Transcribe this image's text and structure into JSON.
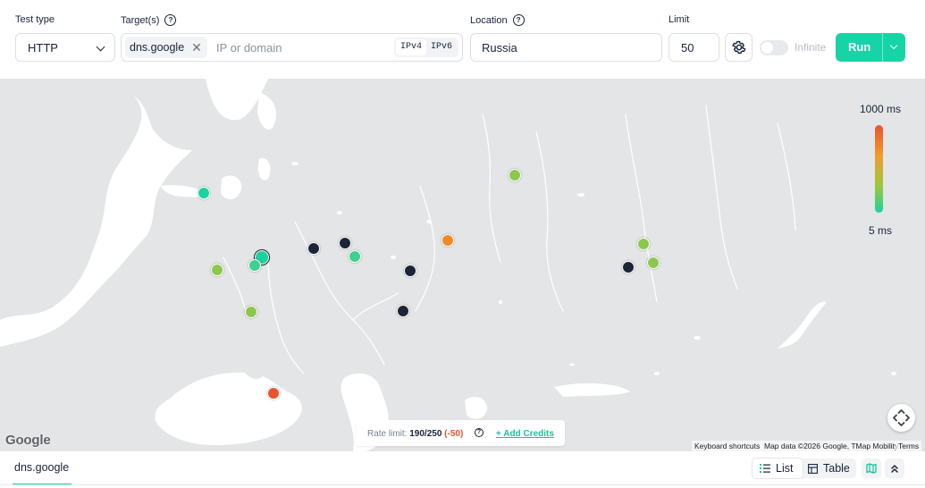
{
  "form": {
    "test_type_label": "Test type",
    "test_type_value": "HTTP",
    "targets_label": "Target(s)",
    "target_chip": "dns.google",
    "target_placeholder": "IP or domain",
    "ip_v4": "IPv4",
    "ip_v6": "IPv6",
    "location_label": "Location",
    "location_value": "Russia",
    "limit_label": "Limit",
    "limit_value": "50",
    "infinite_label": "Infinite",
    "infinite_on": false,
    "run_label": "Run"
  },
  "map": {
    "legend_max": "1000 ms",
    "legend_min": "5 ms",
    "google_logo": "Google",
    "attribution_shortcuts": "Keyboard shortcuts",
    "attribution_data": "Map data ©2026 Google, TMap Mobility",
    "attribution_terms": "Terms",
    "rate_limit_label": "Rate limit:",
    "rate_limit_value": "190/250",
    "rate_limit_delta": "(-50)",
    "add_credits": "+ Add Credits",
    "colors": {
      "ok_teal": "#18d3a0",
      "ok_green": "#3fcf8e",
      "mid_green": "#8cc84b",
      "warn_orange": "#f08a24",
      "bad_red": "#e8542c",
      "pending_navy": "#1c2438"
    },
    "probes": [
      {
        "latency": "low",
        "color": "#18d3a0"
      },
      {
        "latency": "medium",
        "color": "#8cc84b"
      },
      {
        "latency": "pending",
        "color": "#1c2438"
      },
      {
        "latency": "pending",
        "color": "#1c2438"
      },
      {
        "latency": "low",
        "color": "#3fcf8e"
      },
      {
        "latency": "low",
        "color": "#18d3a0"
      },
      {
        "latency": "low",
        "color": "#3fcf8e"
      },
      {
        "latency": "medium",
        "color": "#8cc84b"
      },
      {
        "latency": "high",
        "color": "#f08a24"
      },
      {
        "latency": "pending",
        "color": "#1c2438"
      },
      {
        "latency": "pending",
        "color": "#1c2438"
      },
      {
        "latency": "medium",
        "color": "#8cc84b"
      },
      {
        "latency": "very-high",
        "color": "#e8542c"
      },
      {
        "latency": "medium",
        "color": "#8cc84b"
      },
      {
        "latency": "medium",
        "color": "#8cc84b"
      },
      {
        "latency": "pending",
        "color": "#1c2438"
      }
    ]
  },
  "results": {
    "active_tab": "dns.google",
    "view_list": "List",
    "view_table": "Table"
  }
}
